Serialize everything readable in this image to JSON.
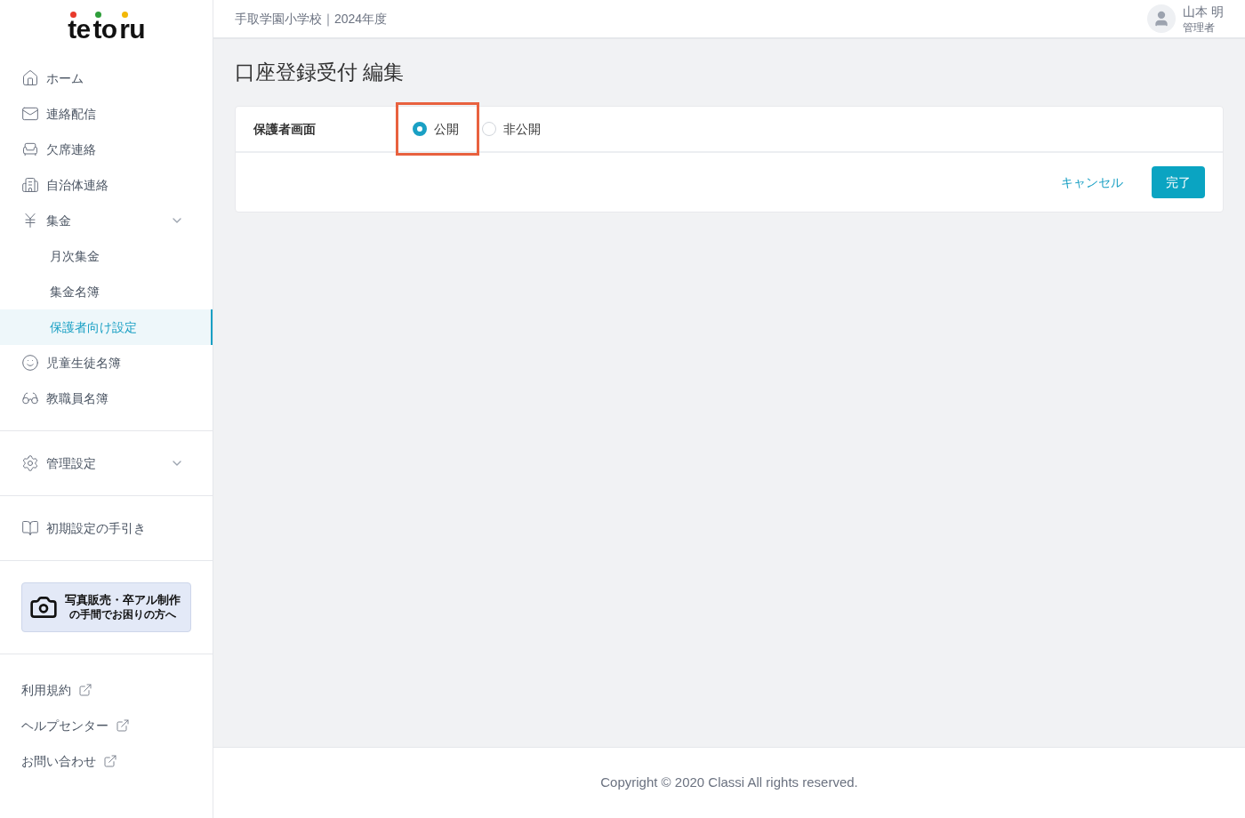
{
  "logo": {
    "parts": [
      {
        "text": "te",
        "color": "#e8392b"
      },
      {
        "text": "to",
        "color": "#2e9e3a"
      },
      {
        "text": "ru",
        "color": "#f2b807"
      }
    ]
  },
  "sidebar": {
    "groups": [
      {
        "items": [
          {
            "kind": "nav",
            "label": "ホーム",
            "selected": false
          },
          {
            "kind": "nav",
            "label": "連絡配信",
            "selected": false
          },
          {
            "kind": "nav",
            "label": "欠席連絡",
            "selected": false
          },
          {
            "kind": "nav",
            "label": "自治体連絡",
            "selected": false
          },
          {
            "kind": "parent",
            "label": "集金",
            "selected": false,
            "expanded": true,
            "children": [
              {
                "label": "月次集金",
                "selected": false
              },
              {
                "label": "集金名簿",
                "selected": false
              },
              {
                "label": "保護者向け設定",
                "selected": true
              }
            ]
          },
          {
            "kind": "nav",
            "label": "児童生徒名簿",
            "selected": false
          },
          {
            "kind": "nav",
            "label": "教職員名簿",
            "selected": false
          }
        ]
      },
      {
        "items": [
          {
            "kind": "parent",
            "label": "管理設定",
            "selected": false
          }
        ]
      },
      {
        "items": [
          {
            "kind": "nav",
            "label": "初期設定の手引き",
            "selected": false
          }
        ]
      }
    ],
    "banner": {
      "title": "写真販売・卒アル制作",
      "subtitle": "の手間でお困りの方へ"
    },
    "links": [
      "利用規約",
      "ヘルプセンター",
      "お問い合わせ"
    ]
  },
  "header": {
    "school": "手取学園小学校｜2024年度",
    "user_name": "山本 明",
    "user_role": "管理者"
  },
  "page_title": "口座登録受付 編集",
  "form": {
    "label": "保護者画面",
    "options": [
      {
        "label": "公開",
        "selected": true,
        "highlighted": true
      },
      {
        "label": "非公開",
        "selected": false,
        "highlighted": false
      }
    ],
    "cancel": "キャンセル",
    "submit": "完了"
  },
  "footer": "Copyright © 2020 Classi All rights reserved."
}
